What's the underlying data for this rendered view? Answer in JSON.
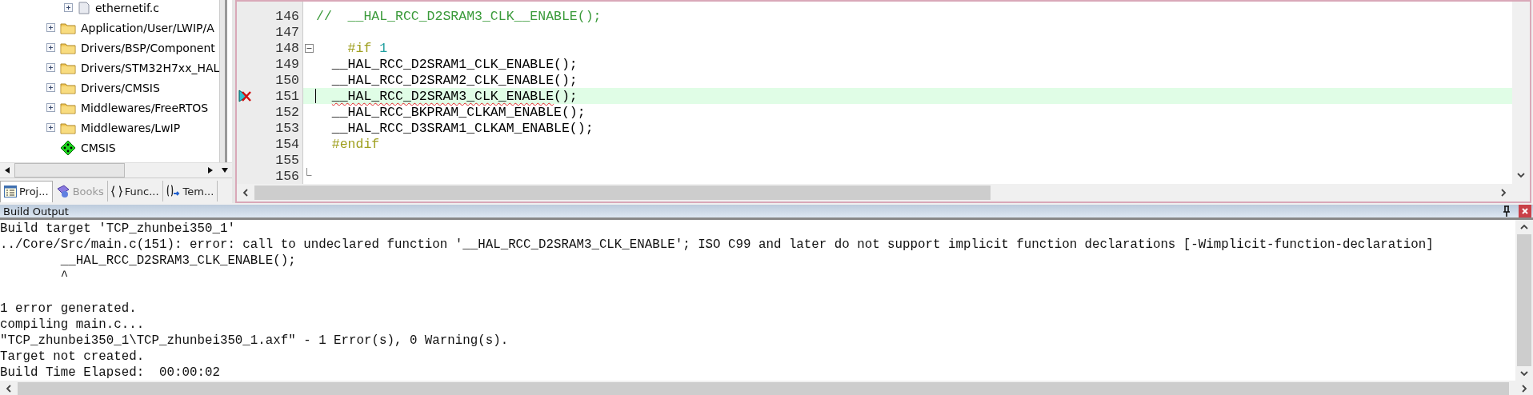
{
  "project_tree": {
    "items": [
      {
        "label": "ethernetif.c",
        "kind": "file",
        "expanded": false
      },
      {
        "label": "Application/User/LWIP/A",
        "kind": "folder",
        "expanded": false
      },
      {
        "label": "Drivers/BSP/Component",
        "kind": "folder",
        "expanded": false
      },
      {
        "label": "Drivers/STM32H7xx_HAL",
        "kind": "folder",
        "expanded": false
      },
      {
        "label": "Drivers/CMSIS",
        "kind": "folder",
        "expanded": false
      },
      {
        "label": "Middlewares/FreeRTOS",
        "kind": "folder",
        "expanded": false
      },
      {
        "label": "Middlewares/LwIP",
        "kind": "folder",
        "expanded": false
      },
      {
        "label": "CMSIS",
        "kind": "component"
      }
    ]
  },
  "panel_tabs": [
    {
      "label": "Proj...",
      "kind": "project",
      "selected": true,
      "disabled": false
    },
    {
      "label": "Books",
      "kind": "books",
      "selected": false,
      "disabled": true
    },
    {
      "label": "Func...",
      "kind": "functions",
      "selected": false,
      "disabled": false
    },
    {
      "label": "Tem...",
      "kind": "templates",
      "selected": false,
      "disabled": false
    }
  ],
  "editor": {
    "lines": [
      {
        "number": "146",
        "selected": false,
        "error": false,
        "kind": "plain",
        "tokens": [
          {
            "text": "//  __HAL_RCC_D2SRAM3_CLK__ENABLE();",
            "kind": "comment"
          }
        ]
      },
      {
        "number": "147",
        "selected": false,
        "error": false,
        "kind": "plain"
      },
      {
        "number": "148",
        "selected": false,
        "error": false,
        "kind": "fold-start",
        "tokens": [
          {
            "text": "    #if ",
            "kind": "preprocessor"
          },
          {
            "text": "1",
            "kind": "number"
          }
        ]
      },
      {
        "number": "149",
        "selected": false,
        "error": false,
        "kind": "plain",
        "tokens": [
          {
            "text": "  __HAL_RCC_D2SRAM1_CLK_ENABLE();",
            "kind": "code"
          }
        ]
      },
      {
        "number": "150",
        "selected": false,
        "error": false,
        "kind": "plain",
        "tokens": [
          {
            "text": "  __HAL_RCC_D2SRAM2_CLK_ENABLE();",
            "kind": "code"
          }
        ]
      },
      {
        "number": "151",
        "selected": true,
        "error": true,
        "kind": "plain",
        "tokens": [
          {
            "text": "  __HAL_RCC_D2SRAM3_CLK_ENABLE",
            "kind": "error"
          },
          {
            "text": "();",
            "kind": "code"
          }
        ]
      },
      {
        "number": "152",
        "selected": false,
        "error": false,
        "kind": "plain",
        "tokens": [
          {
            "text": "  __HAL_RCC_BKPRAM_CLKAM_ENABLE();",
            "kind": "code"
          }
        ]
      },
      {
        "number": "153",
        "selected": false,
        "error": false,
        "kind": "plain",
        "tokens": [
          {
            "text": "  __HAL_RCC_D3SRAM1_CLKAM_ENABLE();",
            "kind": "code"
          }
        ]
      },
      {
        "number": "154",
        "selected": false,
        "error": false,
        "kind": "plain",
        "tokens": [
          {
            "text": "  #endif",
            "kind": "preprocessor"
          }
        ]
      },
      {
        "number": "155",
        "selected": false,
        "error": false,
        "kind": "plain"
      },
      {
        "number": "156",
        "selected": false,
        "error": false,
        "kind": "fold-end"
      }
    ]
  },
  "build_output": {
    "title": "Build Output",
    "lines": [
      {
        "text": "Build target 'TCP_zhunbei350_1'",
        "gap_before": false
      },
      {
        "text": "../Core/Src/main.c(151): error: call to undeclared function '__HAL_RCC_D2SRAM3_CLK_ENABLE'; ISO C99 and later do not support implicit function declarations [-Wimplicit-function-declaration]",
        "gap_before": false
      },
      {
        "text": "        __HAL_RCC_D2SRAM3_CLK_ENABLE();",
        "gap_before": false
      },
      {
        "text": "        ^",
        "gap_before": false
      },
      {
        "text": "1 error generated.",
        "gap_before": true
      },
      {
        "text": "compiling main.c...",
        "gap_before": false
      },
      {
        "text": "\"TCP_zhunbei350_1\\TCP_zhunbei350_1.axf\" - 1 Error(s), 0 Warning(s).",
        "gap_before": false
      },
      {
        "text": "Target not created.",
        "gap_before": false
      },
      {
        "text": "Build Time Elapsed:  00:00:02",
        "gap_before": false
      }
    ]
  }
}
